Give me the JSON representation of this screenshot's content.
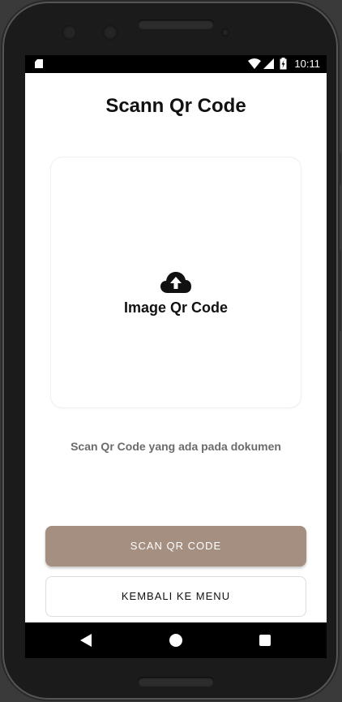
{
  "status_bar": {
    "time": "10:11",
    "icons": [
      "sd-card-icon",
      "wifi-icon",
      "signal-icon",
      "battery-charging-icon"
    ]
  },
  "page": {
    "title": "Scann Qr Code"
  },
  "upload": {
    "icon": "cloud-upload-icon",
    "label": "Image Qr Code"
  },
  "hint": {
    "text": "Scan Qr Code yang ada pada dokumen"
  },
  "buttons": {
    "scan_label": "SCAN QR CODE",
    "back_label": "KEMBALI KE MENU"
  },
  "navigation": {
    "icons": [
      "nav-back-icon",
      "nav-home-icon",
      "nav-recents-icon"
    ]
  },
  "colors": {
    "accent": "#a48f81",
    "text_primary": "#111111",
    "text_muted": "#6b6b6b",
    "background": "#ffffff"
  }
}
